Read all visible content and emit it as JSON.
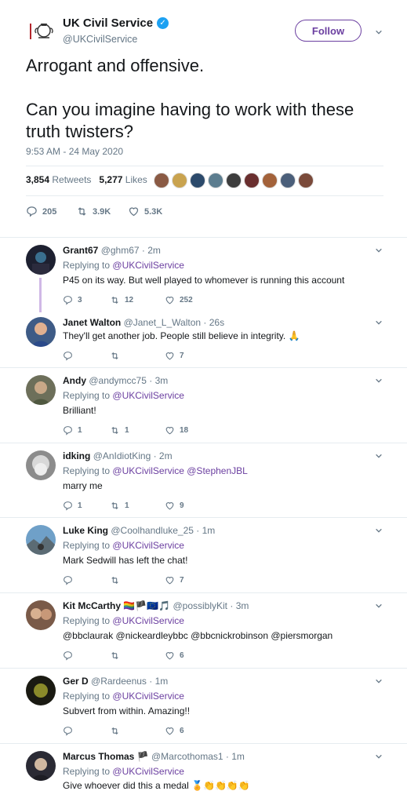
{
  "main_tweet": {
    "account_name": "UK Civil Service",
    "account_handle": "@UKCivilService",
    "follow_label": "Follow",
    "text": "Arrogant and offensive.\n\nCan you imagine having to work with these truth twisters?",
    "timestamp": "9:53 AM - 24 May 2020",
    "retweets_count": "3,854",
    "retweets_label": "Retweets",
    "likes_count": "5,277",
    "likes_label": "Likes",
    "reply_count": "205",
    "retweet_count_short": "3.9K",
    "like_count_short": "5.3K"
  },
  "replies": [
    {
      "name": "Grant67",
      "handle": "@ghm67",
      "time": "· 2m",
      "replying_label": "Replying to",
      "replying_to": "@UKCivilService",
      "text": "P45 on its way. But well played to whomever is running this account",
      "reply_count": "3",
      "retweet_count": "12",
      "like_count": "252"
    },
    {
      "name": "Janet Walton",
      "handle": "@Janet_L_Walton",
      "time": "· 26s",
      "text": "They'll get another job. People still believe in integrity. 🙏",
      "reply_count": "",
      "retweet_count": "",
      "like_count": "7"
    },
    {
      "name": "Andy",
      "handle": "@andymcc75",
      "time": "· 3m",
      "replying_label": "Replying to",
      "replying_to": "@UKCivilService",
      "text": "Brilliant!",
      "reply_count": "1",
      "retweet_count": "1",
      "like_count": "18"
    },
    {
      "name": "idking",
      "handle": "@AnIdiotKing",
      "time": "· 2m",
      "replying_label": "Replying to",
      "replying_to": "@UKCivilService @StephenJBL",
      "text": "marry me",
      "reply_count": "1",
      "retweet_count": "1",
      "like_count": "9"
    },
    {
      "name": "Luke King",
      "handle": "@Coolhandluke_25",
      "time": "· 1m",
      "replying_label": "Replying to",
      "replying_to": "@UKCivilService",
      "text": "Mark Sedwill has left the chat!",
      "reply_count": "",
      "retweet_count": "",
      "like_count": "7"
    },
    {
      "name": "Kit McCarthy",
      "name_emoji": "🏳️‍🌈🏴🇪🇺🎵",
      "handle": "@possiblyKit",
      "time": "· 3m",
      "replying_label": "Replying to",
      "replying_to": "@UKCivilService",
      "text": "@bbclaurak @nickeardleybbc @bbcnickrobinson @piersmorgan",
      "reply_count": "",
      "retweet_count": "",
      "like_count": "6"
    },
    {
      "name": "Ger D",
      "handle": "@Rardeenus",
      "time": "· 1m",
      "replying_label": "Replying to",
      "replying_to": "@UKCivilService",
      "text": "Subvert from within. Amazing!!",
      "reply_count": "",
      "retweet_count": "",
      "like_count": "6"
    },
    {
      "name": "Marcus Thomas",
      "name_emoji": "🏴",
      "handle": "@Marcothomas1",
      "time": "· 1m",
      "replying_label": "Replying to",
      "replying_to": "@UKCivilService",
      "text": "Give whoever did this a medal 🏅👏👏👏👏"
    }
  ],
  "colors": {
    "accent": "#6b3fa0",
    "verified": "#1da1f2",
    "muted": "#657786"
  }
}
